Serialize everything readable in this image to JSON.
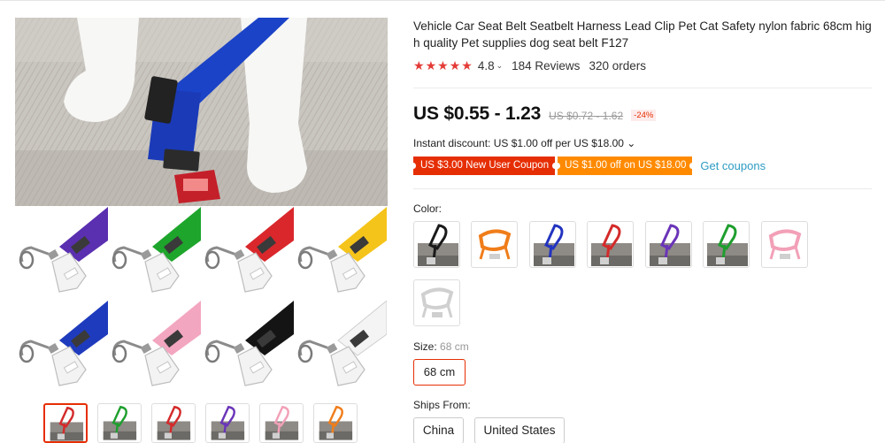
{
  "product": {
    "title": "Vehicle Car Seat Belt Seatbelt Harness Lead Clip Pet Cat Safety nylon fabric 68cm high quality Pet supplies dog seat belt F127",
    "rating": "4.8",
    "reviews": "184 Reviews",
    "orders": "320 orders",
    "price": "US $0.55 - 1.23",
    "old_price": "US $0.72 - 1.62",
    "discount": "-24%",
    "instant_discount": "Instant discount: US $1.00 off per US $18.00 ⌄",
    "coupons": [
      "US $3.00 New User Coupon",
      "US $1.00 off on US $18.00"
    ],
    "get_coupons": "Get coupons"
  },
  "color": {
    "label": "Color:",
    "options": [
      {
        "name": "black",
        "hex": "#1a1a1a"
      },
      {
        "name": "orange",
        "hex": "#f07d1a"
      },
      {
        "name": "blue",
        "hex": "#2233c0"
      },
      {
        "name": "red",
        "hex": "#d42a2a"
      },
      {
        "name": "purple",
        "hex": "#6a34b8"
      },
      {
        "name": "green",
        "hex": "#1f9e2e"
      },
      {
        "name": "pink",
        "hex": "#f2a0b8"
      },
      {
        "name": "white",
        "hex": "#f2f2f2"
      }
    ]
  },
  "size": {
    "label": "Size:",
    "selected": "68 cm",
    "option": "68 cm"
  },
  "ships_from": {
    "label": "Ships From:",
    "options": [
      "China",
      "United States"
    ]
  },
  "gallery": {
    "grid_colors": [
      "#5a2fb0",
      "#1ea52c",
      "#d9272c",
      "#f5c41a",
      "#1f3bbd",
      "#f3a6c0",
      "#141414",
      "#f4f4f4"
    ],
    "thumb_colors": [
      "#d42a2a",
      "#1f9e2e",
      "#d42a2a",
      "#6a34b8",
      "#f2a0b8",
      "#f07d1a"
    ]
  },
  "icons": {
    "star": "star-icon",
    "chevron": "chevron-down-icon"
  }
}
